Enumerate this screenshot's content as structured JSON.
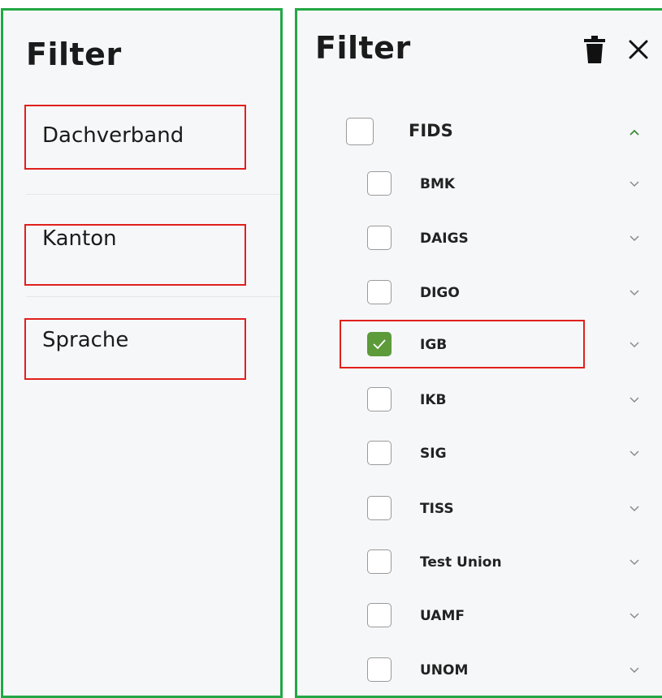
{
  "left_panel": {
    "title": "Filter",
    "sections": [
      {
        "label": "Dachverband"
      },
      {
        "label": "Kanton"
      },
      {
        "label": "Sprache"
      }
    ]
  },
  "right_panel": {
    "title": "Filter",
    "toolbar": {
      "delete_icon": "trash-icon",
      "close_icon": "close-icon"
    },
    "parent": {
      "label": "FIDS",
      "checked": false,
      "expanded": true
    },
    "children": [
      {
        "label": "BMK",
        "checked": false
      },
      {
        "label": "DAIGS",
        "checked": false
      },
      {
        "label": "DIGO",
        "checked": false
      },
      {
        "label": "IGB",
        "checked": true
      },
      {
        "label": "IKB",
        "checked": false
      },
      {
        "label": "SIG",
        "checked": false
      },
      {
        "label": "TISS",
        "checked": false
      },
      {
        "label": "Test Union",
        "checked": false
      },
      {
        "label": "UAMF",
        "checked": false
      },
      {
        "label": "UNOM",
        "checked": false
      }
    ]
  },
  "colors": {
    "panel_border": "#22a845",
    "highlight_border": "#e0201c",
    "checkbox_checked": "#5c9a3a",
    "chevron_expanded": "#3c8a3c",
    "chevron": "#8a8a8a"
  }
}
